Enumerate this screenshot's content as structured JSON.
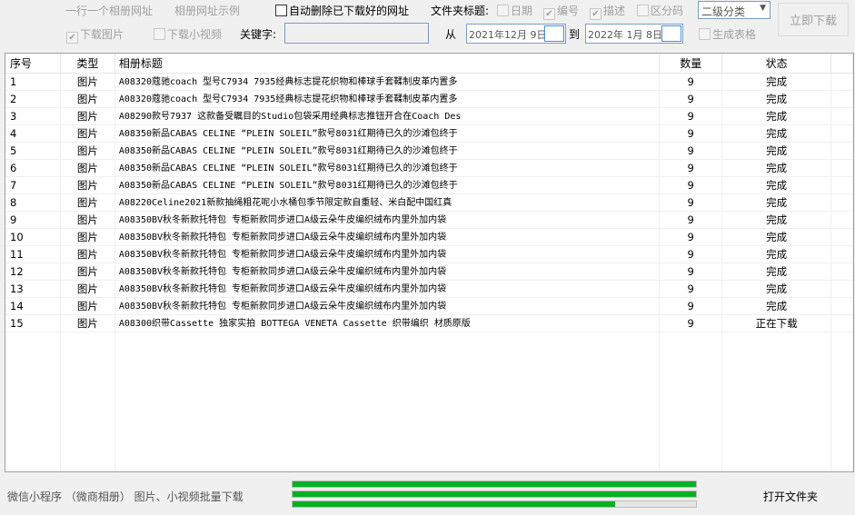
{
  "toolbar": {
    "one_url_per_line": "一行一个相册网址",
    "url_example": "相册网址示例",
    "auto_delete_label": "自动删除已下载好的网址",
    "auto_delete_checked": false,
    "folder_title_label": "文件夹标题:",
    "opt_date": "日期",
    "opt_date_checked": false,
    "opt_number": "编号",
    "opt_number_checked": true,
    "opt_desc": "描述",
    "opt_desc_checked": true,
    "opt_code": "区分码",
    "opt_code_checked": false,
    "category_select": "二级分类",
    "download_now": "立即下载",
    "download_images": "下载图片",
    "download_images_checked": true,
    "download_videos": "下载小视频",
    "download_videos_checked": false,
    "keyword_label": "关键字:",
    "keyword_value": "",
    "from_label": "从",
    "from_date": "2021年12月 9日",
    "to_label": "到",
    "to_date": "2022年 1月 8日",
    "generate_table": "生成表格",
    "generate_table_checked": false
  },
  "table": {
    "headers": [
      "序号",
      "类型",
      "相册标题",
      "数量",
      "状态"
    ],
    "rows": [
      [
        "1",
        "图片",
        "A08320蔻驰coach 型号C7934 7935经典标志提花织物和棒球手套鞣制皮革内置多",
        "9",
        "完成"
      ],
      [
        "2",
        "图片",
        "A08320蔻驰coach 型号C7934 7935经典标志提花织物和棒球手套鞣制皮革内置多",
        "9",
        "完成"
      ],
      [
        "3",
        "图片",
        "A08290款号7937 这款备受瞩目的Studio包袋采用经典标志推钮开合在Coach Des",
        "9",
        "完成"
      ],
      [
        "4",
        "图片",
        "A08350新品CABAS CELINE “PLEIN SOLEIL”款号8031红期待已久的沙滩包终于",
        "9",
        "完成"
      ],
      [
        "5",
        "图片",
        "A08350新品CABAS CELINE “PLEIN SOLEIL”款号8031红期待已久的沙滩包终于",
        "9",
        "完成"
      ],
      [
        "6",
        "图片",
        "A08350新品CABAS CELINE “PLEIN SOLEIL”款号8031红期待已久的沙滩包终于",
        "9",
        "完成"
      ],
      [
        "7",
        "图片",
        "A08350新品CABAS CELINE “PLEIN SOLEIL”款号8031红期待已久的沙滩包终于",
        "9",
        "完成"
      ],
      [
        "8",
        "图片",
        "A08220Celine2021新款抽绳粗花呢小水桶包季节限定款自重轻、米白配中国红真",
        "9",
        "完成"
      ],
      [
        "9",
        "图片",
        "A08350BV秋冬新款托特包 专柜新款同步进口A级云朵牛皮编织绒布内里外加内袋",
        "9",
        "完成"
      ],
      [
        "10",
        "图片",
        "A08350BV秋冬新款托特包 专柜新款同步进口A级云朵牛皮编织绒布内里外加内袋",
        "9",
        "完成"
      ],
      [
        "11",
        "图片",
        "A08350BV秋冬新款托特包 专柜新款同步进口A级云朵牛皮编织绒布内里外加内袋",
        "9",
        "完成"
      ],
      [
        "12",
        "图片",
        "A08350BV秋冬新款托特包 专柜新款同步进口A级云朵牛皮编织绒布内里外加内袋",
        "9",
        "完成"
      ],
      [
        "13",
        "图片",
        "A08350BV秋冬新款托特包 专柜新款同步进口A级云朵牛皮编织绒布内里外加内袋",
        "9",
        "完成"
      ],
      [
        "14",
        "图片",
        "A08350BV秋冬新款托特包 专柜新款同步进口A级云朵牛皮编织绒布内里外加内袋",
        "9",
        "完成"
      ],
      [
        "15",
        "图片",
        "A08300织带Cassette 独家实拍 BOTTEGA VENETA Cassette 织带编织 材质原版",
        "9",
        "正在下载"
      ]
    ]
  },
  "footer": {
    "app_label": "微信小程序 （微商相册） 图片、小视频批量下载",
    "progress": [
      1.0,
      1.0,
      0.8
    ],
    "progress_color": "#06b025",
    "open_folder": "打开文件夹"
  }
}
